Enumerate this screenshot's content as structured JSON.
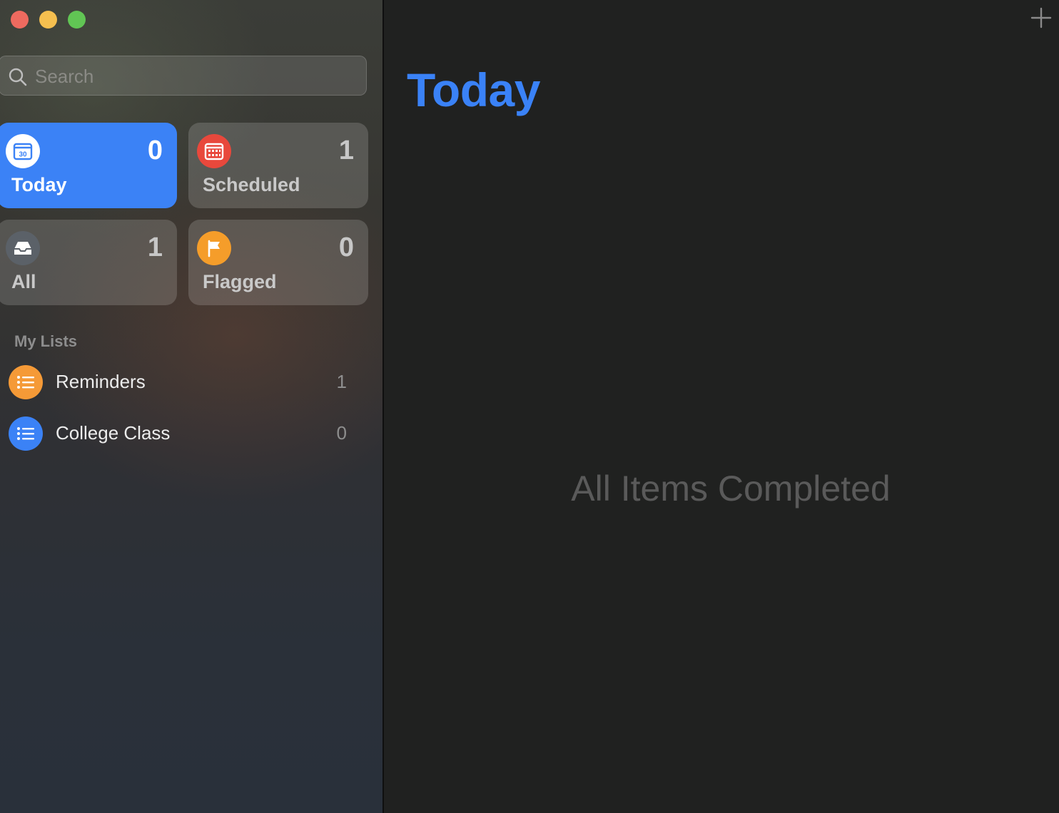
{
  "window": {
    "controls": [
      "close",
      "minimize",
      "zoom"
    ],
    "colors": {
      "close": "#ee6a5f",
      "minimize": "#f5bf4f",
      "zoom": "#61c554"
    }
  },
  "sidebar": {
    "search": {
      "placeholder": "Search",
      "value": "",
      "icon": "search-icon"
    },
    "smart_lists": [
      {
        "id": "today",
        "label": "Today",
        "count": "0",
        "icon": "calendar-icon",
        "icon_text": "30",
        "color": "#3b82f6",
        "selected": true
      },
      {
        "id": "scheduled",
        "label": "Scheduled",
        "count": "1",
        "icon": "calendar-grid-icon",
        "color": "#e8483c",
        "selected": false
      },
      {
        "id": "all",
        "label": "All",
        "count": "1",
        "icon": "tray-icon",
        "color": "#5b6168",
        "selected": false
      },
      {
        "id": "flagged",
        "label": "Flagged",
        "count": "0",
        "icon": "flag-icon",
        "color": "#f59d2a",
        "selected": false
      }
    ],
    "my_lists_title": "My Lists",
    "my_lists": [
      {
        "name": "Reminders",
        "count": "1",
        "icon": "list-bullet-icon",
        "color": "#f59a37"
      },
      {
        "name": "College Class",
        "count": "0",
        "icon": "list-bullet-icon",
        "color": "#3b82f6"
      }
    ]
  },
  "main": {
    "title": "Today",
    "title_color": "#3a82f7",
    "empty_state": "All Items Completed",
    "add_icon": "plus-icon"
  }
}
